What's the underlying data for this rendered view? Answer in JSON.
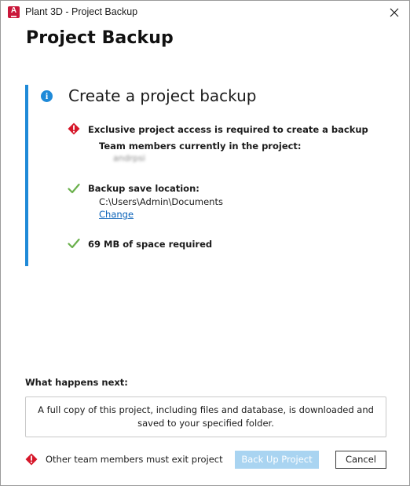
{
  "window": {
    "title": "Plant 3D - Project Backup",
    "app_icon_letter": "A",
    "app_icon_color": "#c9173a"
  },
  "page_title": "Project Backup",
  "info": {
    "accent_color": "#1f8ad8",
    "icon": "info-icon",
    "heading": "Create a project backup",
    "items": [
      {
        "status": "warning",
        "icon": "warning-icon",
        "text": "Exclusive project access is required to create a backup",
        "subheading": "Team members currently in the project:",
        "members": [
          "andrpsi"
        ]
      },
      {
        "status": "ok",
        "icon": "check-icon",
        "text": "Backup save location:",
        "path": "C:\\Users\\Admin\\Documents",
        "link": "Change"
      },
      {
        "status": "ok",
        "icon": "check-icon",
        "text": "69 MB of space required"
      }
    ]
  },
  "next": {
    "label": "What happens next:",
    "description": "A full copy of this project, including files and database, is downloaded and saved to your specified folder."
  },
  "footer": {
    "warning_icon": "warning-icon",
    "warning_text": "Other team members must exit project",
    "primary_button": "Back Up Project",
    "primary_enabled": false,
    "cancel_button": "Cancel"
  },
  "colors": {
    "warning": "#d6172a",
    "check": "#6ab04c",
    "link": "#0a62b8",
    "primary_disabled": "#a9d4f1"
  }
}
